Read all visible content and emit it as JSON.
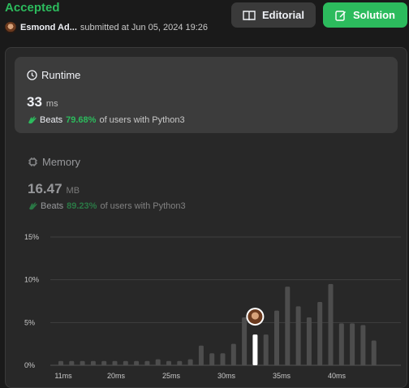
{
  "header": {
    "status": "Accepted",
    "user": "Esmond Ad...",
    "submitted": "submitted at Jun 05, 2024 19:26",
    "editorial_label": "Editorial",
    "solution_label": "Solution"
  },
  "runtime": {
    "title": "Runtime",
    "value": "33",
    "unit": "ms",
    "beats_word": "Beats",
    "beats_pct": "79.68%",
    "beats_suffix": "of users with Python3"
  },
  "memory": {
    "title": "Memory",
    "value": "16.47",
    "unit": "MB",
    "beats_word": "Beats",
    "beats_pct": "89.23%",
    "beats_suffix": "of users with Python3"
  },
  "colors": {
    "accent": "#2cbb5d",
    "bar": "#4d4d4d",
    "bar_selected": "#ffffff",
    "background": "#1a1a1a"
  },
  "chart_data": {
    "type": "bar",
    "title": "",
    "xlabel": "",
    "ylabel": "",
    "yticks": [
      "15%",
      "10%",
      "5%",
      "0%"
    ],
    "ylim": [
      0,
      15
    ],
    "xticks": [
      "11ms",
      "20ms",
      "25ms",
      "30ms",
      "35ms",
      "40ms"
    ],
    "grid": true,
    "bar_values": [
      0.5,
      0.5,
      0.5,
      0.5,
      0.5,
      0.5,
      0.5,
      0.5,
      0.5,
      0.7,
      0.5,
      0.5,
      0.7,
      2.3,
      1.4,
      1.4,
      2.5,
      5.6,
      3.6,
      3.6,
      6.4,
      9.2,
      6.9,
      5.6,
      7.4,
      9.5,
      4.9,
      4.9,
      4.7,
      2.9
    ],
    "selected_index": 18,
    "selected_value": 3.6
  }
}
